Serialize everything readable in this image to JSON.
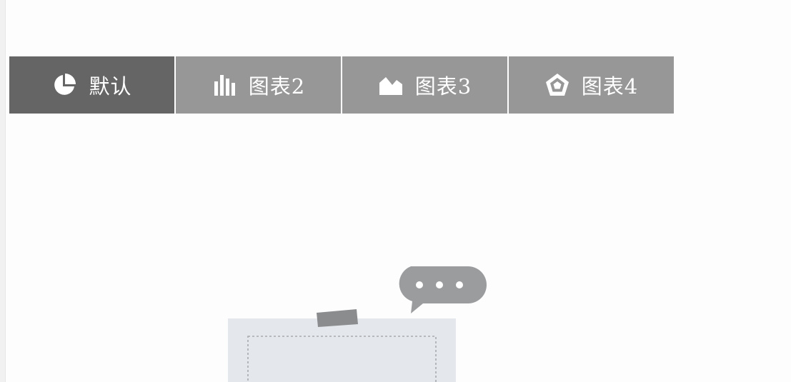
{
  "tabs": [
    {
      "label": "默认",
      "icon": "pie-chart-icon",
      "active": true
    },
    {
      "label": "图表2",
      "icon": "bar-chart-icon",
      "active": false
    },
    {
      "label": "图表3",
      "icon": "area-chart-icon",
      "active": false
    },
    {
      "label": "图表4",
      "icon": "radar-chart-icon",
      "active": false
    }
  ],
  "colors": {
    "tab_bg": "#979797",
    "tab_active_bg": "#656565",
    "tab_text": "#ffffff",
    "illustration_gray": "#e4e7eb",
    "bubble_gray": "#9a9c9e"
  }
}
